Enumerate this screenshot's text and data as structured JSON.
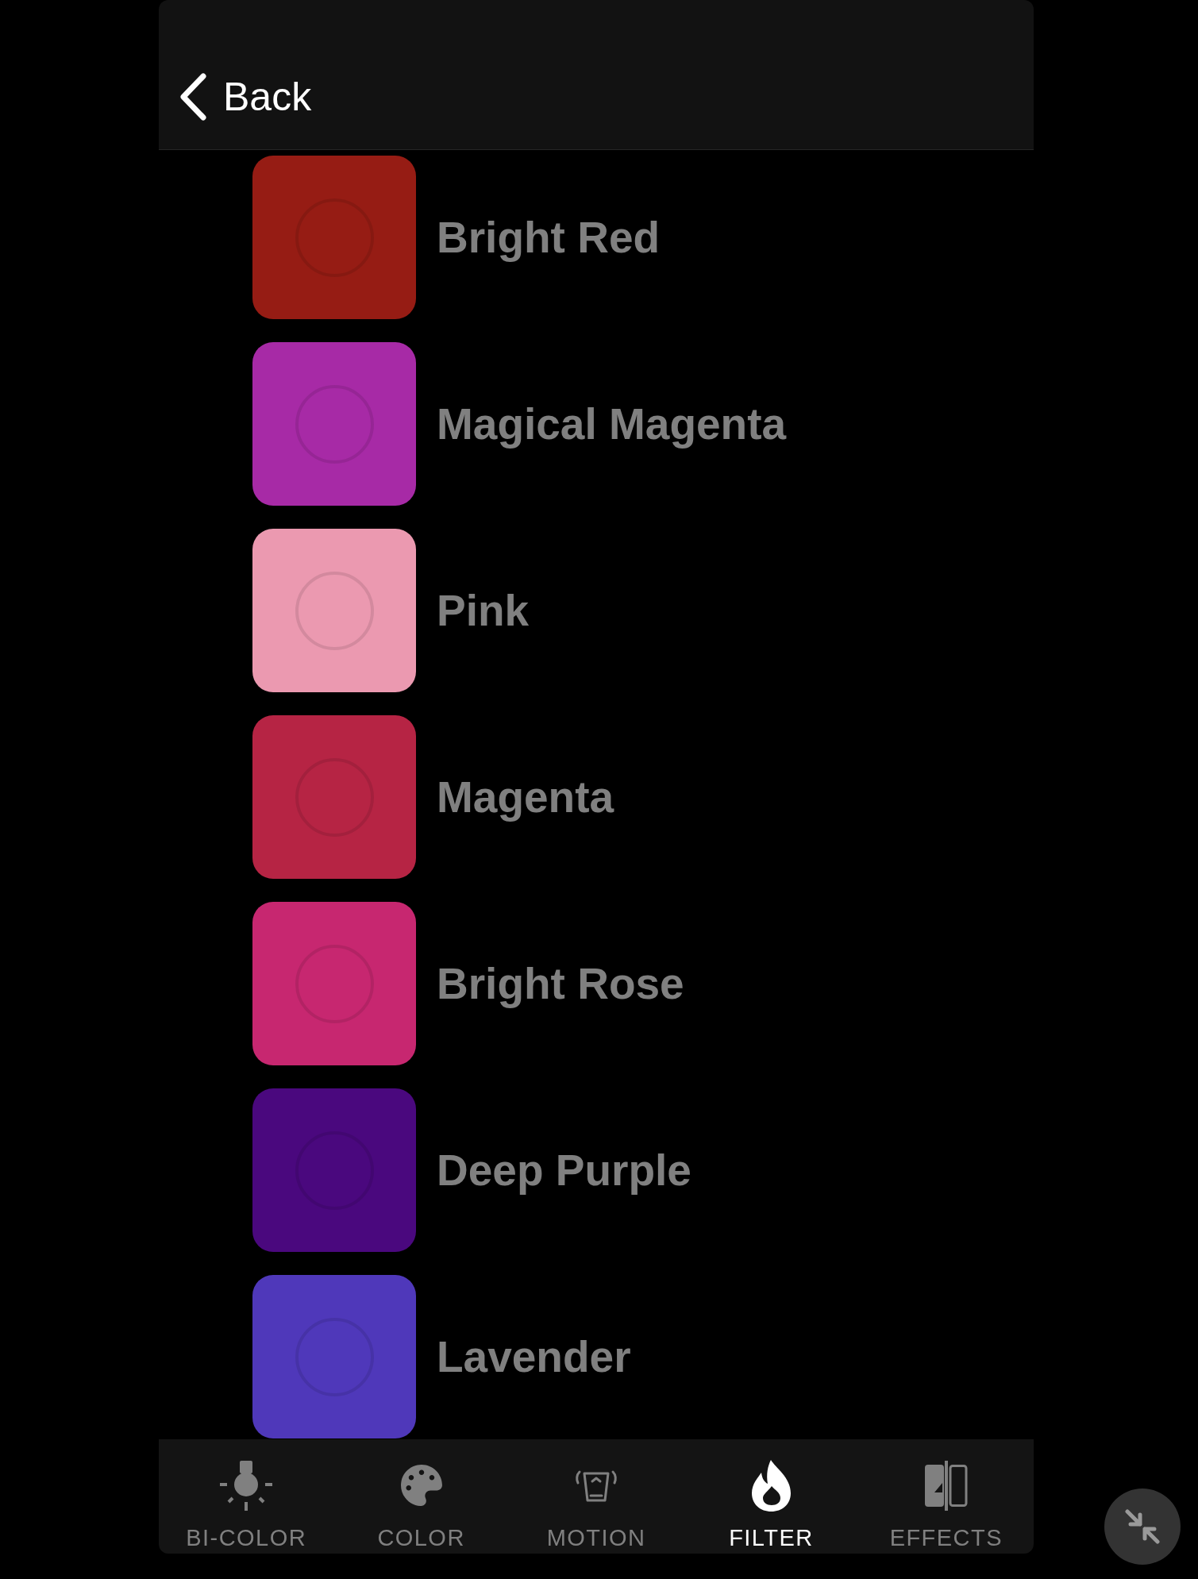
{
  "header": {
    "back_label": "Back"
  },
  "colors": [
    {
      "name": "Bright Red",
      "color": "#961c14"
    },
    {
      "name": "Magical Magenta",
      "color": "#a72aa6"
    },
    {
      "name": "Pink",
      "color": "#eb99b0"
    },
    {
      "name": "Magenta",
      "color": "#b62444"
    },
    {
      "name": "Bright Rose",
      "color": "#c72770"
    },
    {
      "name": "Deep Purple",
      "color": "#4a087e"
    },
    {
      "name": "Lavender",
      "color": "#4f38ba"
    }
  ],
  "tabs": [
    {
      "label": "BI-COLOR",
      "selected": false
    },
    {
      "label": "COLOR",
      "selected": false
    },
    {
      "label": "MOTION",
      "selected": false
    },
    {
      "label": "FILTER",
      "selected": true
    },
    {
      "label": "EFFECTS",
      "selected": false
    }
  ]
}
